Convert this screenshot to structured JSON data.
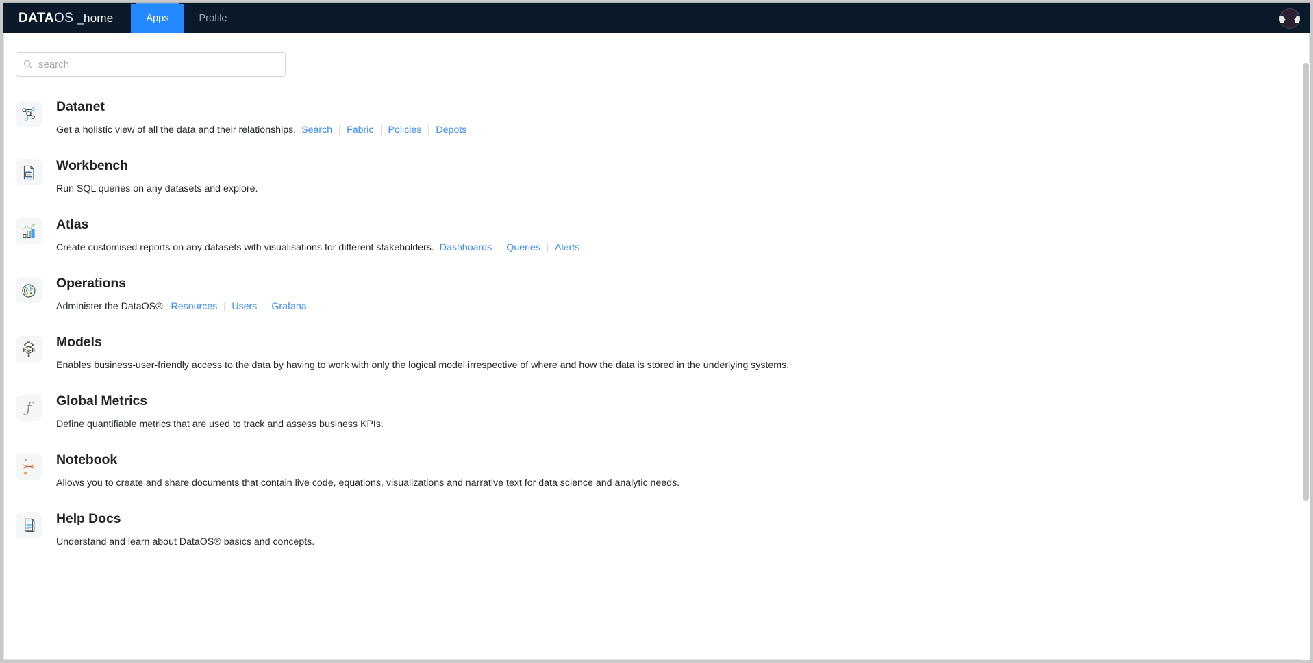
{
  "nav": {
    "brand": {
      "data": "DATA",
      "os": "OS",
      "home": "_home"
    },
    "tabs": [
      {
        "label": "Apps",
        "active": true
      },
      {
        "label": "Profile",
        "active": false
      }
    ],
    "avatar_name": "user-avatar",
    "active_color": "#2489ff",
    "bar_color": "#0b1a2a"
  },
  "search": {
    "placeholder": "search",
    "value": "",
    "icon": "search-icon"
  },
  "apps": [
    {
      "id": "datanet",
      "title": "Datanet",
      "description": "Get a holistic view of all the data and their relationships.",
      "icon": "network-graph-icon",
      "links": [
        "Search",
        "Fabric",
        "Policies",
        "Depots"
      ]
    },
    {
      "id": "workbench",
      "title": "Workbench",
      "description": "Run SQL queries on any datasets and explore.",
      "icon": "sql-document-icon",
      "links": []
    },
    {
      "id": "atlas",
      "title": "Atlas",
      "description": "Create customised reports on any datasets with visualisations for different stakeholders.",
      "icon": "bar-chart-icon",
      "links": [
        "Dashboards",
        "Queries",
        "Alerts"
      ]
    },
    {
      "id": "operations",
      "title": "Operations",
      "description": "Administer the DataOS®.",
      "icon": "radar-icon",
      "links": [
        "Resources",
        "Users",
        "Grafana"
      ]
    },
    {
      "id": "models",
      "title": "Models",
      "description": "Enables business-user-friendly access to the data by having to work with only the logical model irrespective of where and how the data is stored in the underlying systems.",
      "icon": "layered-diamond-icon",
      "links": []
    },
    {
      "id": "global-metrics",
      "title": "Global Metrics",
      "description": "Define quantifiable metrics that are used to track and assess business KPIs.",
      "icon": "function-f-icon",
      "links": []
    },
    {
      "id": "notebook",
      "title": "Notebook",
      "description": "Allows you to create and share documents that contain live code, equations, visualizations and narrative text for data science and analytic needs.",
      "icon": "jupyter-icon",
      "links": []
    },
    {
      "id": "help-docs",
      "title": "Help Docs",
      "description": "Understand and learn about DataOS® basics and concepts.",
      "icon": "help-document-icon",
      "links": []
    }
  ],
  "colors": {
    "link": "#3b8cf5",
    "title": "#1f2328",
    "nav_bg": "#0b1a2a",
    "accent": "#2489ff"
  }
}
